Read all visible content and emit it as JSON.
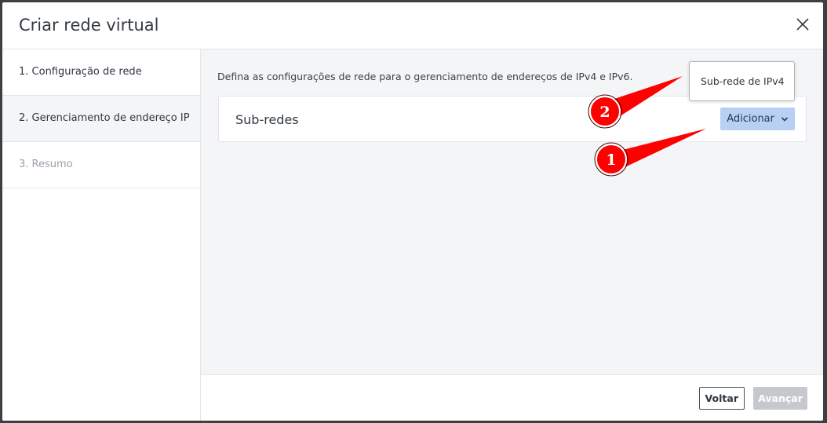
{
  "dialog": {
    "title": "Criar rede virtual",
    "close_icon": "close-icon"
  },
  "sidebar": {
    "steps": [
      {
        "label": "1. Configuração de rede",
        "state": "normal"
      },
      {
        "label": "2. Gerenciamento de endereço IP",
        "state": "active"
      },
      {
        "label": "3. Resumo",
        "state": "disabled"
      }
    ]
  },
  "main": {
    "description": "Defina as configurações de rede para o gerenciamento de endereços de IPv4 e IPv6.",
    "card": {
      "title": "Sub-redes",
      "add_button_label": "Adicionar"
    },
    "dropdown": {
      "items": [
        "Sub-rede de IPv4"
      ]
    }
  },
  "footer": {
    "back_label": "Voltar",
    "next_label": "Avançar"
  },
  "annotations": {
    "markers": [
      "1",
      "2"
    ],
    "color": "#ff0000"
  },
  "colors": {
    "accent_button": "#b7d0f3",
    "panel_bg": "#f4f5f7",
    "disabled_button": "#c5c8cc"
  }
}
